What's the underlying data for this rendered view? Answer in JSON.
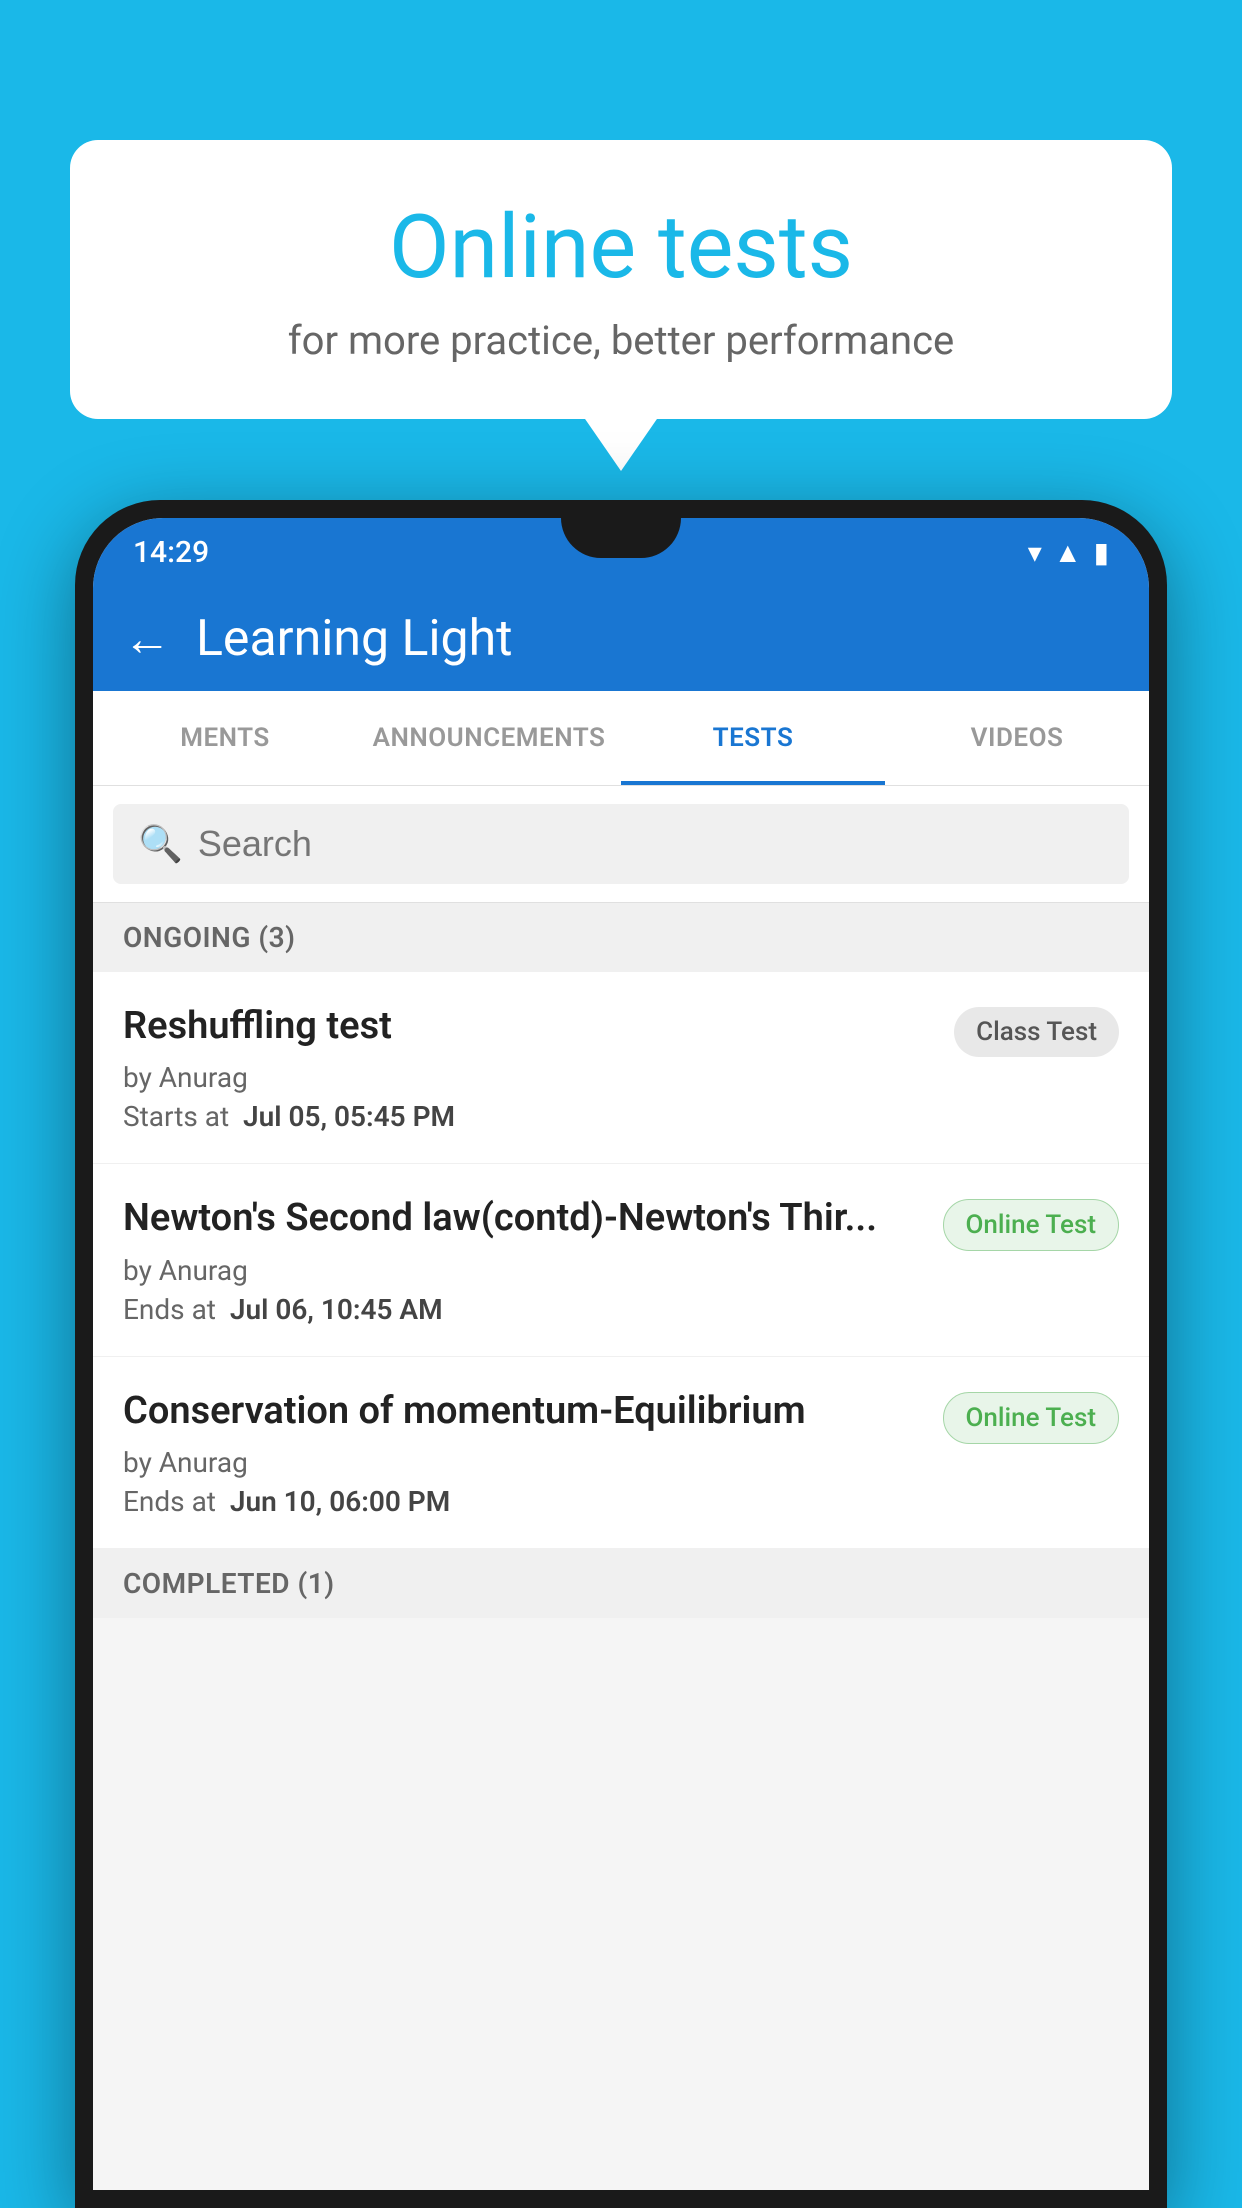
{
  "background_color": "#1ab8e8",
  "bubble": {
    "title": "Online tests",
    "subtitle": "for more practice, better performance"
  },
  "phone": {
    "status_bar": {
      "time": "14:29",
      "icons": [
        "wifi",
        "signal",
        "battery"
      ]
    },
    "app_bar": {
      "back_label": "←",
      "title": "Learning Light"
    },
    "tabs": [
      {
        "label": "MENTS",
        "active": false
      },
      {
        "label": "ANNOUNCEMENTS",
        "active": false
      },
      {
        "label": "TESTS",
        "active": true
      },
      {
        "label": "VIDEOS",
        "active": false
      }
    ],
    "search": {
      "placeholder": "Search"
    },
    "sections": [
      {
        "header": "ONGOING (3)",
        "items": [
          {
            "title": "Reshuffling test",
            "author": "by Anurag",
            "time_label": "Starts at",
            "time_value": "Jul 05, 05:45 PM",
            "badge": "Class Test",
            "badge_type": "class"
          },
          {
            "title": "Newton's Second law(contd)-Newton's Thir...",
            "author": "by Anurag",
            "time_label": "Ends at",
            "time_value": "Jul 06, 10:45 AM",
            "badge": "Online Test",
            "badge_type": "online"
          },
          {
            "title": "Conservation of momentum-Equilibrium",
            "author": "by Anurag",
            "time_label": "Ends at",
            "time_value": "Jun 10, 06:00 PM",
            "badge": "Online Test",
            "badge_type": "online"
          }
        ]
      },
      {
        "header": "COMPLETED (1)",
        "items": []
      }
    ]
  }
}
